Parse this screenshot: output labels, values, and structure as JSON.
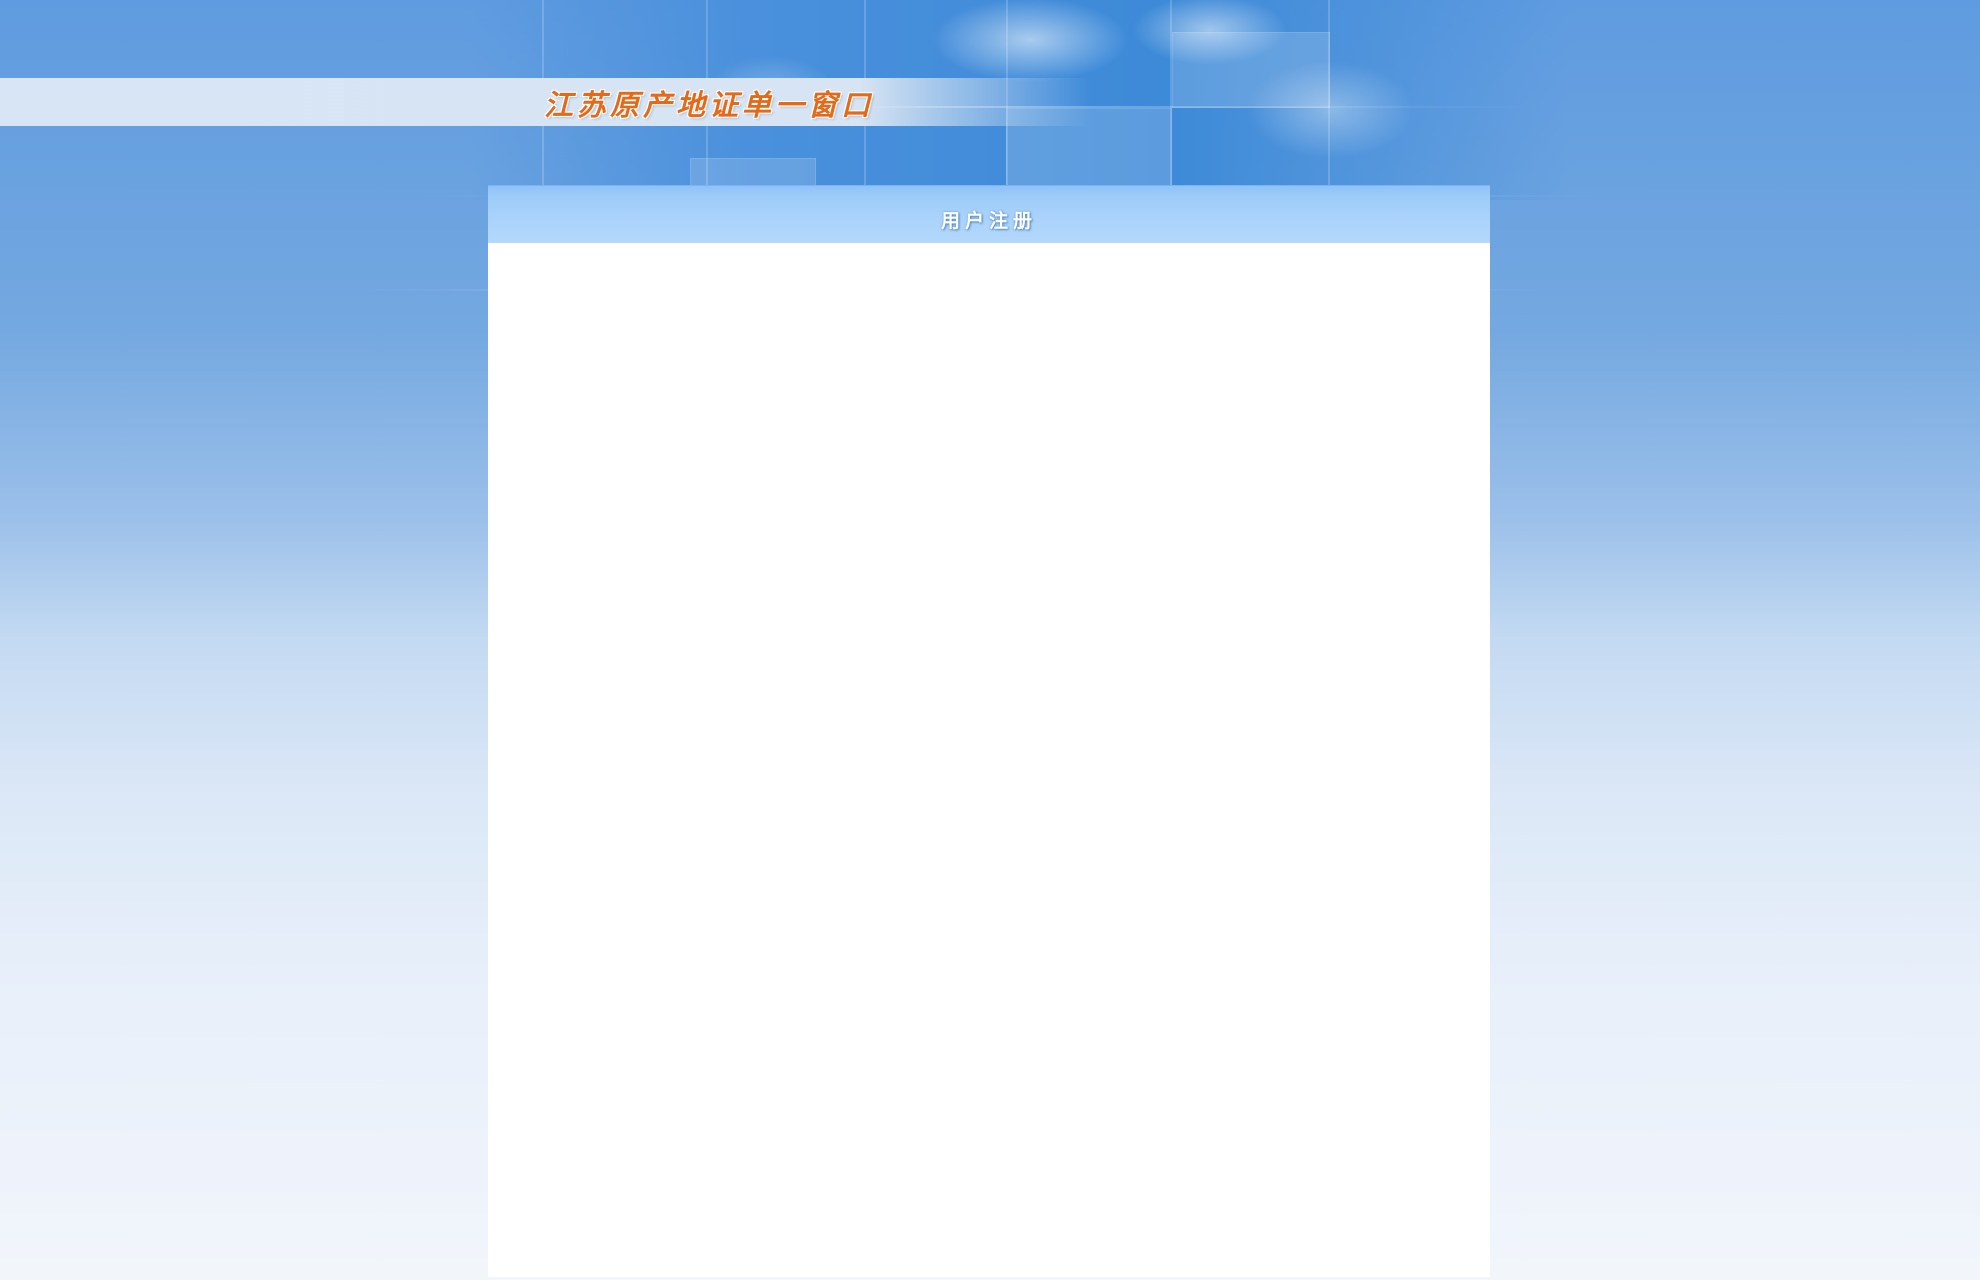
{
  "header": {
    "site_title": "江苏原产地证单一窗口"
  },
  "panel": {
    "title": "用户注册"
  },
  "colors": {
    "title_orange": "#e26a1a",
    "panel_header_blue": "#a9d2fb",
    "sky_blue": "#4a90dc",
    "page_bg_light": "#eef3fb"
  }
}
